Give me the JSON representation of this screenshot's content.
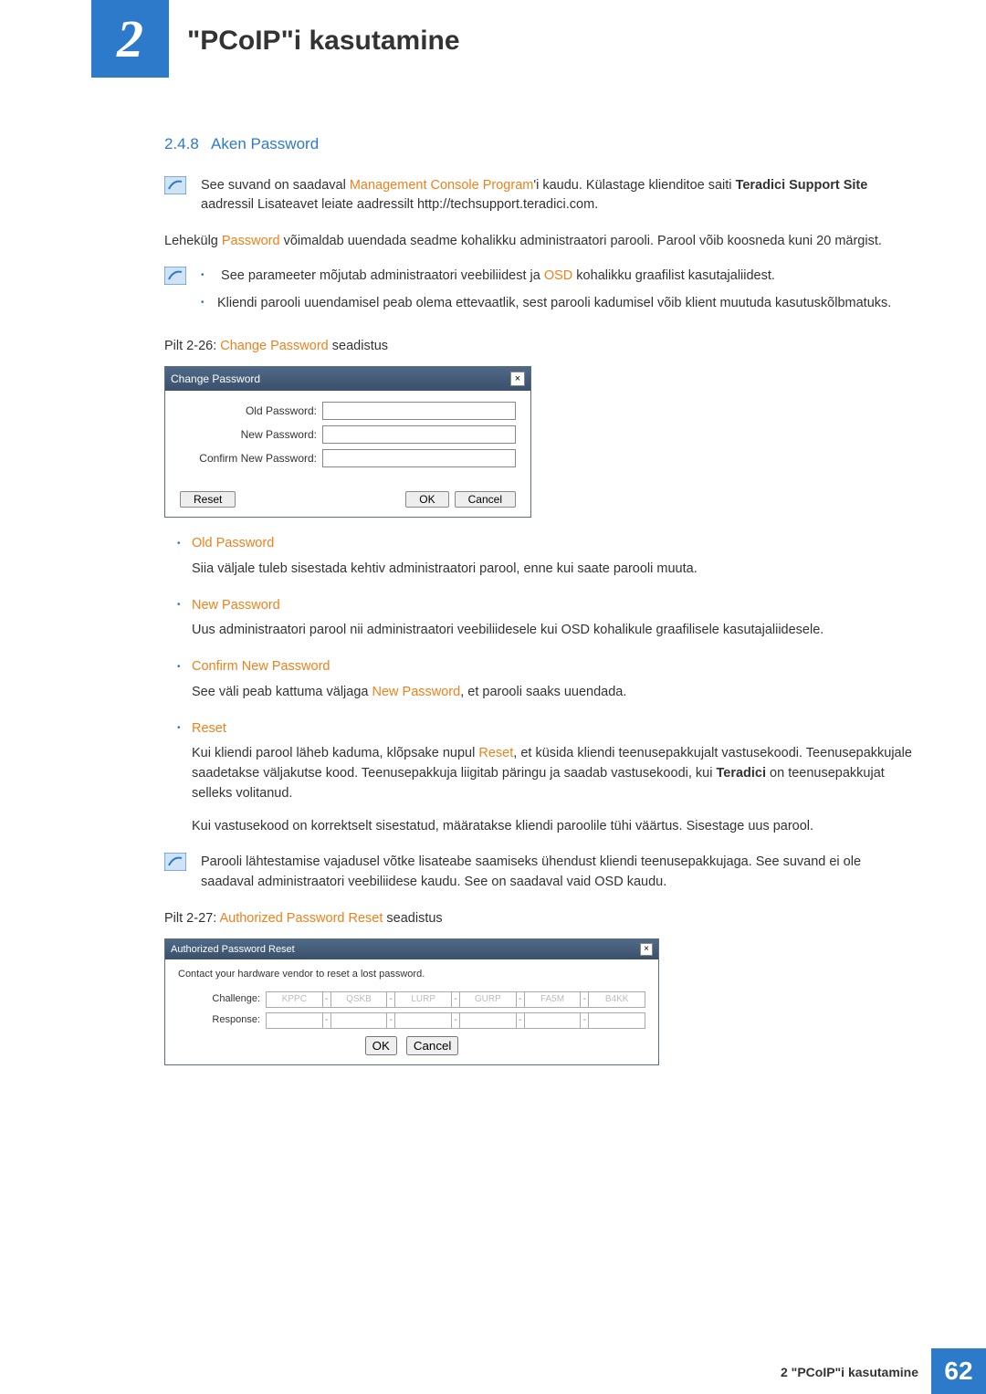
{
  "header": {
    "chapter_number": "2",
    "chapter_title": "\"PCoIP\"i kasutamine"
  },
  "section": {
    "number": "2.4.8",
    "title": "Aken Password"
  },
  "info1": {
    "pre": "See suvand on saadaval ",
    "link": "Management Console Program",
    "mid": "'i kaudu. Külastage klienditoe saiti ",
    "bold": "Teradici Support Site",
    "post": " aadressil Lisateavet leiate aadressilt http://techsupport.teradici.com."
  },
  "para1": {
    "pre": "Lehekülg ",
    "kw": "Password",
    "post": " võimaldab uuendada seadme kohalikku administraatori parooli. Parool võib koosneda kuni 20 märgist."
  },
  "info2": {
    "line1_pre": "See parameeter mõjutab administraatori veebiliidest ja ",
    "line1_kw": "OSD",
    "line1_post": " kohalikku graafilist kasutajaliidest.",
    "line2": "Kliendi parooli uuendamisel peab olema ettevaatlik, sest parooli kadumisel võib klient muutuda kasutuskõlbmatuks."
  },
  "caption1": {
    "pre": "Pilt 2-26: ",
    "kw": "Change Password",
    "post": " seadistus"
  },
  "dialog1": {
    "title": "Change Password",
    "old": "Old Password:",
    "new": "New Password:",
    "confirm": "Confirm New Password:",
    "reset": "Reset",
    "ok": "OK",
    "cancel": "Cancel"
  },
  "defs": {
    "old": {
      "term": "Old Password",
      "desc": "Siia väljale tuleb sisestada kehtiv administraatori parool, enne kui saate parooli muuta."
    },
    "new": {
      "term": "New Password",
      "desc": "Uus administraatori parool nii administraatori veebiliidesele kui OSD kohalikule graafilisele kasutajaliidesele."
    },
    "confirm": {
      "term": "Confirm New Password",
      "desc_pre": "See väli peab kattuma väljaga ",
      "desc_kw": "New Password",
      "desc_post": ", et parooli saaks uuendada."
    },
    "reset": {
      "term": "Reset",
      "desc1_pre": "Kui kliendi parool läheb kaduma, klõpsake nupul ",
      "desc1_kw": "Reset",
      "desc1_mid": ", et küsida kliendi teenusepakkujalt vastusekoodi. Teenusepakkujale saadetakse väljakutse kood. Teenusepakkuja liigitab päringu ja saadab vastusekoodi, kui ",
      "desc1_bold": "Teradici",
      "desc1_post": " on teenusepakkujat selleks volitanud.",
      "desc2": "Kui vastusekood on korrektselt sisestatud, määratakse kliendi paroolile tühi väärtus. Sisestage uus parool."
    }
  },
  "info3": "Parooli lähtestamise vajadusel võtke lisateabe saamiseks ühendust kliendi teenusepakkujaga. See suvand ei ole saadaval administraatori veebiliidese kaudu. See on saadaval vaid OSD kaudu.",
  "caption2": {
    "pre": "Pilt 2-27: ",
    "kw": "Authorized Password Reset",
    "post": " seadistus"
  },
  "dialog2": {
    "title": "Authorized Password Reset",
    "instr": "Contact your hardware vendor to reset a lost password.",
    "challenge_lbl": "Challenge:",
    "response_lbl": "Response:",
    "challenge": [
      "KPPC",
      "QSKB",
      "LURP",
      "GURP",
      "FA5M",
      "B4KK"
    ],
    "ok": "OK",
    "cancel": "Cancel"
  },
  "footer": {
    "text": "2 \"PCoIP\"i kasutamine",
    "page": "62"
  }
}
